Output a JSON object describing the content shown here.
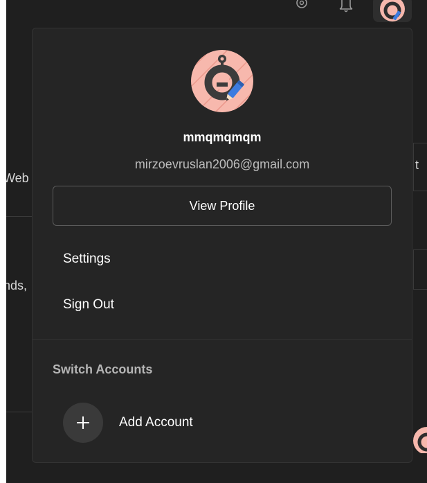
{
  "topbar": {
    "icons": [
      "gear-icon",
      "bell-icon"
    ],
    "avatar": "avatar-icon"
  },
  "background": {
    "fragment_web": "Web",
    "fragment_nds": "nds,",
    "fragment_t": "t"
  },
  "profile_menu": {
    "username": "mmqmqmqm",
    "email": "mirzoevruslan2006@gmail.com",
    "view_profile_label": "View Profile",
    "items": [
      {
        "label": "Settings"
      },
      {
        "label": "Sign Out"
      }
    ],
    "switch_accounts": {
      "title": "Switch Accounts",
      "add_account_label": "Add Account",
      "add_icon": "plus-icon"
    }
  },
  "colors": {
    "panel_bg": "#252525",
    "app_bg": "#1f1f1f",
    "avatar_bg": "#f7b8ad",
    "avatar_accent": "#3b3b3b",
    "pencil_blue": "#3c7be0"
  }
}
